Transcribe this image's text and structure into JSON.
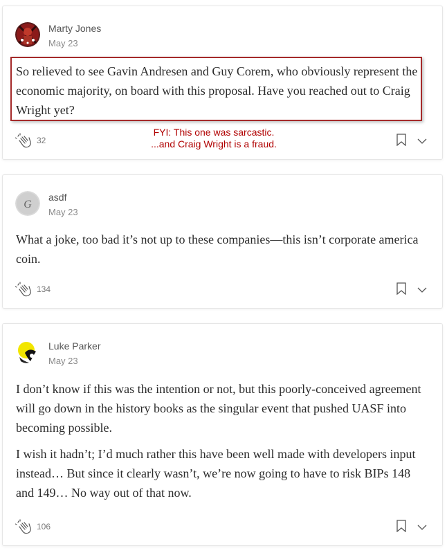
{
  "comments": [
    {
      "author": "Marty Jones",
      "date": "May 23",
      "paragraphs": [
        "So relieved to see Gavin Andresen and Guy Corem, who obviously represent the economic majority, on board with this proposal. Have you reached out to Craig Wright yet?"
      ],
      "claps": "32",
      "annotation": {
        "line1": "FYI: This one was sarcastic.",
        "line2": "...and Craig Wright is a fraud.",
        "color": "#b00000"
      }
    },
    {
      "author": "asdf",
      "date": "May 23",
      "paragraphs": [
        "What a joke, too bad it’s not up to these companies—this isn’t corporate america coin."
      ],
      "claps": "134"
    },
    {
      "author": "Luke Parker",
      "date": "May 23",
      "paragraphs": [
        "I don’t know if this was the intention or not, but this poorly-conceived agreement will go down in the history books as the singular event that pushed UASF into becoming possible.",
        "I wish it hadn’t; I’d much rather this have been well made with developers input instead… But since it clearly wasn’t, we’re now going to have to risk BIPs 148 and 149… No way out of that now."
      ],
      "claps": "106"
    }
  ],
  "icons": {
    "clap": "clap-icon",
    "bookmark": "bookmark-icon",
    "more": "chevron-down-icon"
  },
  "colors": {
    "highlight_border": "#a52a2a",
    "annotation_text": "#b00000"
  }
}
